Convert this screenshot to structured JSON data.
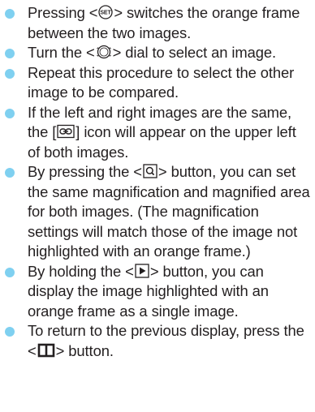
{
  "bullet_color": "#7fd0f0",
  "text_color": "#231f20",
  "items": [
    {
      "before": "Pressing <",
      "icon": "set-button-icon",
      "after": "> switches the orange frame between the two images."
    },
    {
      "before": "Turn the <",
      "icon": "quick-control-dial-icon",
      "after": "> dial to select an image."
    },
    {
      "text": "Repeat this procedure to select the other image to be compared."
    },
    {
      "before": "If the left and right images are the same, the [",
      "icon": "same-image-link-icon",
      "after": "] icon will appear on the upper left of both images."
    },
    {
      "before": "By pressing the <",
      "icon": "magnify-button-icon",
      "after": "> button, you can set the same magnification and magnified area for both images. (The magnification settings will match those of the image not highlighted with an orange frame.)"
    },
    {
      "before": "By holding the <",
      "icon": "playback-button-icon",
      "after": "> button, you can display the image highlighted with an orange frame as a single image."
    },
    {
      "before": "To return to the previous display, press the <",
      "icon": "two-image-display-button-icon",
      "after": "> button."
    }
  ]
}
